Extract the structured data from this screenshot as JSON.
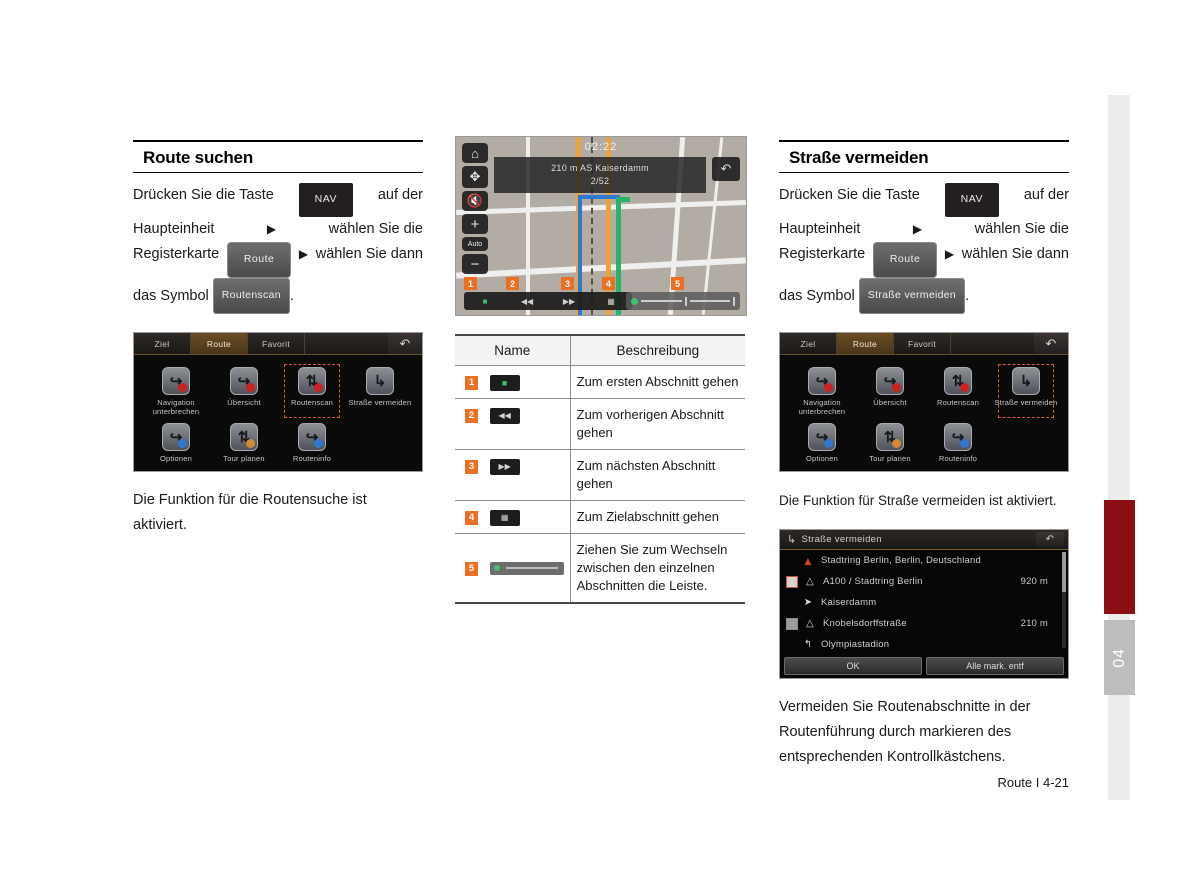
{
  "page": {
    "footer": "Route I 4-21",
    "chapter_tab": "04"
  },
  "left": {
    "heading": "Route suchen",
    "steps": {
      "l1_a": "Drücken Sie die Taste",
      "btn_nav": "NAV",
      "l1_b": "auf der",
      "l2": "Haupteinheit",
      "l2_b": "wählen Sie die",
      "l3_a": "Registerkarte",
      "btn_route": "Route",
      "l3_b": "wählen Sie dann",
      "l4_a": "das Symbol",
      "btn_symbol": "Routenscan",
      "l4_b": "."
    },
    "device": {
      "tabs": [
        "Ziel",
        "Route",
        "Favorit"
      ],
      "back_icon": "back-arrow-icon",
      "active_tab": "Route",
      "items": [
        {
          "label": "Navigation\nunterbrechen",
          "icon": "navigation-stop-icon",
          "dot": "#cc2222",
          "selected": false
        },
        {
          "label": "Übersicht",
          "icon": "route-overview-icon",
          "dot": "#cc2222",
          "selected": false
        },
        {
          "label": "Routenscan",
          "icon": "route-scan-icon",
          "dot": "#cc2222",
          "selected": true
        },
        {
          "label": "Straße\nvermeiden",
          "icon": "avoid-street-icon",
          "dot": "",
          "selected": false
        },
        {
          "label": "Optionen",
          "icon": "route-options-icon",
          "dot": "#2f78d0",
          "selected": false
        },
        {
          "label": "Tour planen",
          "icon": "plan-tour-icon",
          "dot": "#d08a3a",
          "selected": false
        },
        {
          "label": "Routeninfo",
          "icon": "route-info-icon",
          "dot": "#2f78d0",
          "selected": false
        }
      ]
    },
    "caption_l1": "Die Funktion für die Routensuche ist",
    "caption_l2": "aktiviert."
  },
  "center": {
    "map": {
      "clock": "02:22",
      "info_line1": "210 m  AS Kaiserdamm",
      "info_line2": "2/52",
      "home_icon": "home-icon",
      "compass_icon": "compass-icon",
      "mute_icon": "mute-speaker-icon",
      "zoom_in": "+",
      "zoom_level": "Auto",
      "zoom_out": "−",
      "back_icon": "back-arrow-icon",
      "badges": [
        "1",
        "2",
        "3",
        "4",
        "5"
      ],
      "bottom_buttons": [
        "first-section-icon",
        "prev-section-icon",
        "next-section-icon",
        "destination-section-icon"
      ],
      "slider": "section-slider"
    },
    "table": {
      "headers": [
        "Name",
        "Beschreibung"
      ],
      "rows": [
        {
          "num": "1",
          "icon": "first-section-icon",
          "desc": "Zum ersten Abschnitt gehen"
        },
        {
          "num": "2",
          "icon": "prev-section-icon",
          "desc": "Zum vorherigen Abschnitt gehen"
        },
        {
          "num": "3",
          "icon": "next-section-icon",
          "desc": "Zum nächsten Abschnitt gehen"
        },
        {
          "num": "4",
          "icon": "destination-section-icon",
          "desc": "Zum Zielabschnitt gehen"
        },
        {
          "num": "5",
          "icon": "section-slider-bar",
          "desc": "Ziehen Sie zum Wechseln zwischen den einzelnen Abschnitten die Leiste."
        }
      ]
    }
  },
  "right": {
    "heading": "Straße vermeiden",
    "steps": {
      "l1_a": "Drücken Sie die Taste",
      "btn_nav": "NAV",
      "l1_b": "auf der",
      "l2": "Haupteinheit",
      "l2_b": "wählen Sie die",
      "l3_a": "Registerkarte",
      "btn_route": "Route",
      "l3_b": "wählen Sie dann",
      "l4_a": "das Symbol",
      "btn_symbol": "Straße vermeiden",
      "l4_b": "."
    },
    "device": {
      "tabs": [
        "Ziel",
        "Route",
        "Favorit"
      ],
      "active_tab": "Route",
      "items": [
        {
          "label": "Navigation\nunterbrechen",
          "icon": "navigation-stop-icon",
          "dot": "#cc2222",
          "selected": false
        },
        {
          "label": "Übersicht",
          "icon": "route-overview-icon",
          "dot": "#cc2222",
          "selected": false
        },
        {
          "label": "Routenscan",
          "icon": "route-scan-icon",
          "dot": "#cc2222",
          "selected": false
        },
        {
          "label": "Straße\nvermeiden",
          "icon": "avoid-street-icon",
          "dot": "",
          "selected": true
        },
        {
          "label": "Optionen",
          "icon": "route-options-icon",
          "dot": "#2f78d0",
          "selected": false
        },
        {
          "label": "Tour planen",
          "icon": "plan-tour-icon",
          "dot": "#d08a3a",
          "selected": false
        },
        {
          "label": "Routeninfo",
          "icon": "route-info-icon",
          "dot": "#2f78d0",
          "selected": false
        }
      ]
    },
    "caption": "Die Funktion für Straße vermeiden ist aktiviert.",
    "dialog": {
      "title": "Straße vermeiden",
      "back_icon": "back-arrow-icon",
      "rows": [
        {
          "check": "none",
          "icon": "destination-marker-icon",
          "name": "Stadtring Berlin, Berlin, Deutschland",
          "dist": ""
        },
        {
          "check": "on",
          "icon": "highway-icon",
          "name": "A100 / Stadtring Berlin",
          "dist": "920 m"
        },
        {
          "check": "none",
          "icon": "turn-right-icon",
          "name": "Kaiserdamm",
          "dist": ""
        },
        {
          "check": "off",
          "icon": "highway-icon",
          "name": "Knobelsdorffstraße",
          "dist": "210 m"
        },
        {
          "check": "none",
          "icon": "turn-left-icon",
          "name": "Olympiastadion",
          "dist": ""
        }
      ],
      "buttons": [
        "OK",
        "Alle mark. entf"
      ]
    },
    "caption_b_l1": "Vermeiden Sie Routenabschnitte in der",
    "caption_b_l2": "Routenführung durch markieren des",
    "caption_b_l3": "entsprechenden Kontrollkästchens."
  }
}
